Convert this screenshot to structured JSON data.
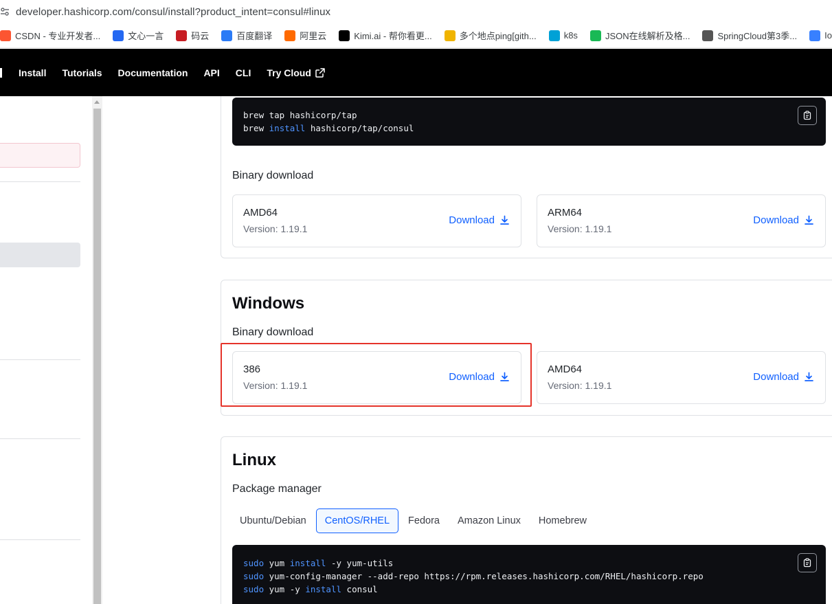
{
  "browser": {
    "url": "developer.hashicorp.com/consul/install?product_intent=consul#linux",
    "bookmarks": [
      {
        "label": "CSDN - 专业开发者...",
        "icon": "csdn-icon",
        "color": "#fc5531"
      },
      {
        "label": "文心一言",
        "icon": "wenxin-icon",
        "color": "#2468f2"
      },
      {
        "label": "码云",
        "icon": "gitee-icon",
        "color": "#c71d23"
      },
      {
        "label": "百度翻译",
        "icon": "baidu-translate-icon",
        "color": "#2b7bf6"
      },
      {
        "label": "阿里云",
        "icon": "aliyun-icon",
        "color": "#ff6a00"
      },
      {
        "label": "Kimi.ai - 帮你看更...",
        "icon": "kimi-icon",
        "color": "#000000"
      },
      {
        "label": "多个地点ping[gith...",
        "icon": "ping-icon",
        "color": "#f0b400"
      },
      {
        "label": "k8s",
        "icon": "bilibili-icon",
        "color": "#00a1d6"
      },
      {
        "label": "JSON在线解析及格...",
        "icon": "json-icon",
        "color": "#19b955"
      },
      {
        "label": "SpringCloud第3季...",
        "icon": "doc-icon",
        "color": "#555555"
      },
      {
        "label": "Ionic App",
        "icon": "ionic-icon",
        "color": "#3880ff"
      }
    ]
  },
  "nav": {
    "items": [
      "Install",
      "Tutorials",
      "Documentation",
      "API",
      "CLI"
    ],
    "try_cloud": "Try Cloud"
  },
  "brew_section": {
    "code_lines": [
      [
        {
          "t": "brew tap hashicorp/tap",
          "kw": false
        }
      ],
      [
        {
          "t": "brew ",
          "kw": false
        },
        {
          "t": "install",
          "kw": true
        },
        {
          "t": " hashicorp/tap/consul",
          "kw": false
        }
      ]
    ],
    "binary_heading": "Binary download",
    "downloads": [
      {
        "arch": "AMD64",
        "version": "Version: 1.19.1",
        "link": "Download"
      },
      {
        "arch": "ARM64",
        "version": "Version: 1.19.1",
        "link": "Download"
      }
    ]
  },
  "windows_section": {
    "title": "Windows",
    "binary_heading": "Binary download",
    "downloads": [
      {
        "arch": "386",
        "version": "Version: 1.19.1",
        "link": "Download"
      },
      {
        "arch": "AMD64",
        "version": "Version: 1.19.1",
        "link": "Download"
      }
    ]
  },
  "linux_section": {
    "title": "Linux",
    "package_heading": "Package manager",
    "tabs": [
      "Ubuntu/Debian",
      "CentOS/RHEL",
      "Fedora",
      "Amazon Linux",
      "Homebrew"
    ],
    "active_tab": "CentOS/RHEL",
    "code_lines": [
      [
        {
          "t": "sudo",
          "kw": true
        },
        {
          "t": " yum ",
          "kw": false
        },
        {
          "t": "install",
          "kw": true
        },
        {
          "t": " -y yum-utils",
          "kw": false
        }
      ],
      [
        {
          "t": "sudo",
          "kw": true
        },
        {
          "t": " yum-config-manager --add-repo https://rpm.releases.hashicorp.com/RHEL/hashicorp.repo",
          "kw": false
        }
      ],
      [
        {
          "t": "sudo",
          "kw": true
        },
        {
          "t": " yum -y ",
          "kw": false
        },
        {
          "t": "install",
          "kw": true
        },
        {
          "t": " consul",
          "kw": false
        }
      ]
    ]
  },
  "colors": {
    "accent_blue": "#1060ff",
    "highlight_red": "#e5332a",
    "code_bg": "#0d0e12",
    "code_keyword": "#4f94ff"
  }
}
